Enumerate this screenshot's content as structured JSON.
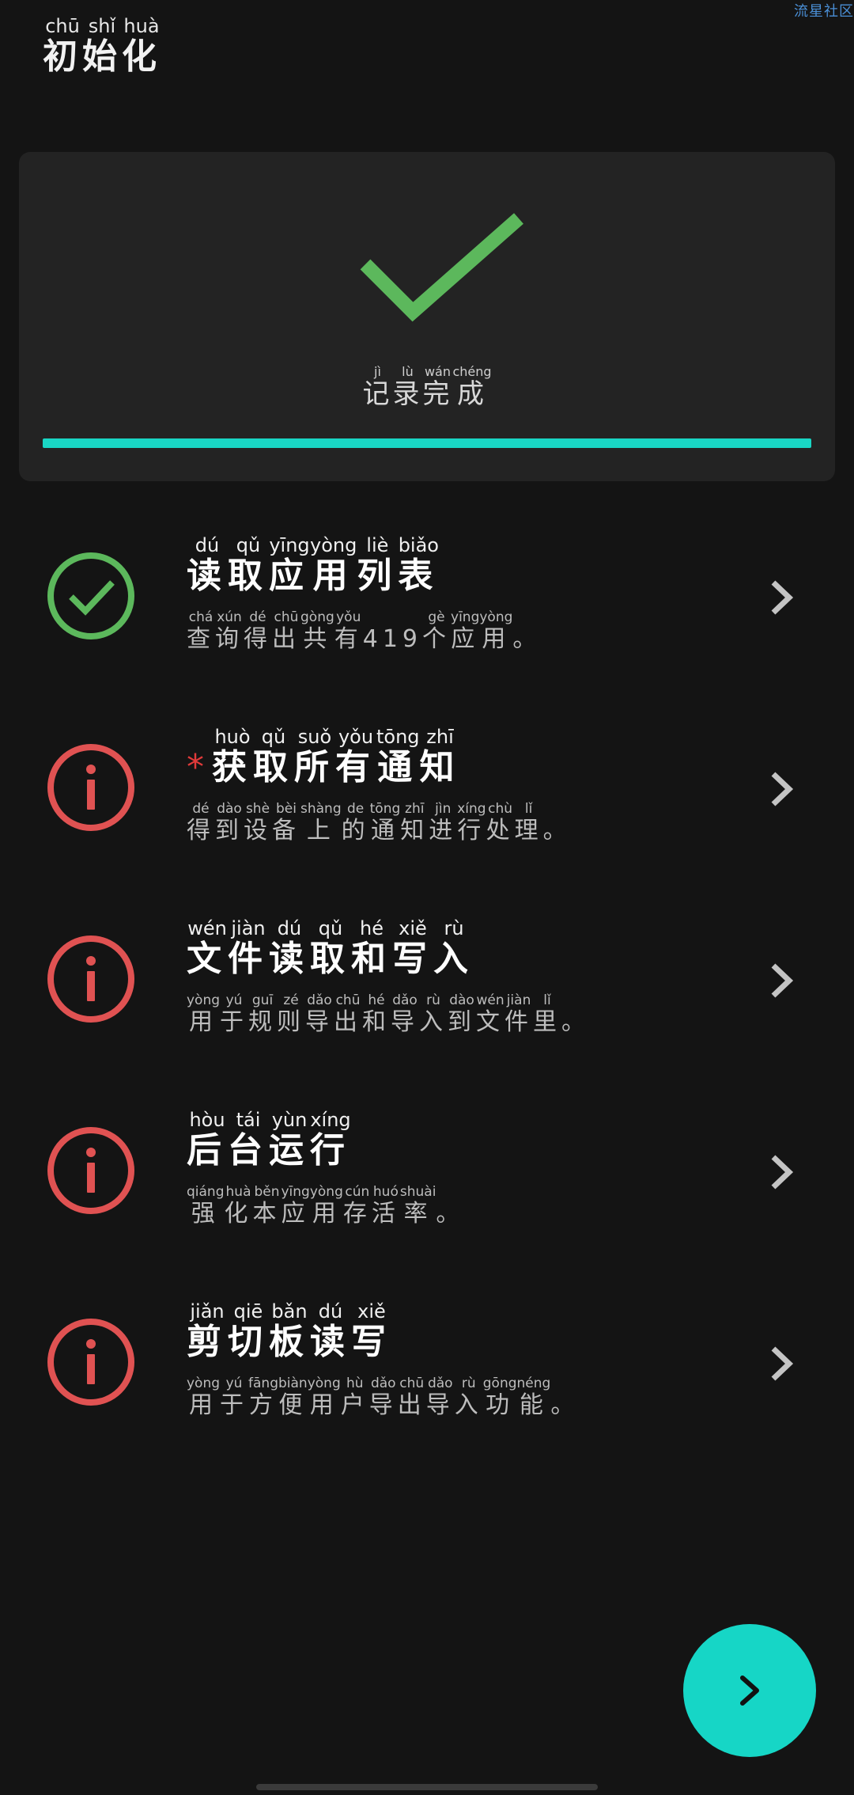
{
  "watermark": "流星社区",
  "header": {
    "title": [
      {
        "ch": "初",
        "py": "chū"
      },
      {
        "ch": "始",
        "py": "shǐ"
      },
      {
        "ch": "化",
        "py": "huà"
      }
    ]
  },
  "status": {
    "text": [
      {
        "ch": "记",
        "py": "jì"
      },
      {
        "ch": "录",
        "py": "lù"
      },
      {
        "ch": "完",
        "py": "wán"
      },
      {
        "ch": "成",
        "py": "chéng"
      }
    ],
    "progress_percent": 100,
    "check_color": "#5cb85c",
    "progress_color": "#19d6c4"
  },
  "permissions": [
    {
      "status": "granted",
      "required": false,
      "title": [
        {
          "ch": "读",
          "py": "dú"
        },
        {
          "ch": "取",
          "py": "qǔ"
        },
        {
          "ch": "应",
          "py": "yīng"
        },
        {
          "ch": "用",
          "py": "yòng"
        },
        {
          "ch": "列",
          "py": "liè"
        },
        {
          "ch": "表",
          "py": "biǎo"
        }
      ],
      "desc": [
        {
          "ch": "查",
          "py": "chá"
        },
        {
          "ch": "询",
          "py": "xún"
        },
        {
          "ch": "得",
          "py": "dé"
        },
        {
          "ch": "出",
          "py": "chū"
        },
        {
          "ch": "共",
          "py": "gòng"
        },
        {
          "ch": "有",
          "py": "yǒu"
        },
        {
          "ch": "419",
          "py": ""
        },
        {
          "ch": "个",
          "py": "gè"
        },
        {
          "ch": "应",
          "py": "yīng"
        },
        {
          "ch": "用",
          "py": "yòng"
        },
        {
          "ch": "。",
          "py": ""
        }
      ]
    },
    {
      "status": "not-granted",
      "required": true,
      "required_mark": "*",
      "title": [
        {
          "ch": "获",
          "py": "huò"
        },
        {
          "ch": "取",
          "py": "qǔ"
        },
        {
          "ch": "所",
          "py": "suǒ"
        },
        {
          "ch": "有",
          "py": "yǒu"
        },
        {
          "ch": "通",
          "py": "tōng"
        },
        {
          "ch": "知",
          "py": "zhī"
        }
      ],
      "desc": [
        {
          "ch": "得",
          "py": "dé"
        },
        {
          "ch": "到",
          "py": "dào"
        },
        {
          "ch": "设",
          "py": "shè"
        },
        {
          "ch": "备",
          "py": "bèi"
        },
        {
          "ch": "上",
          "py": "shàng"
        },
        {
          "ch": "的",
          "py": "de"
        },
        {
          "ch": "通",
          "py": "tōng"
        },
        {
          "ch": "知",
          "py": "zhī"
        },
        {
          "ch": "进",
          "py": "jìn"
        },
        {
          "ch": "行",
          "py": "xíng"
        },
        {
          "ch": "处",
          "py": "chù"
        },
        {
          "ch": "理",
          "py": "lǐ"
        },
        {
          "ch": "。",
          "py": ""
        }
      ]
    },
    {
      "status": "not-granted",
      "required": false,
      "title": [
        {
          "ch": "文",
          "py": "wén"
        },
        {
          "ch": "件",
          "py": "jiàn"
        },
        {
          "ch": "读",
          "py": "dú"
        },
        {
          "ch": "取",
          "py": "qǔ"
        },
        {
          "ch": "和",
          "py": "hé"
        },
        {
          "ch": "写",
          "py": "xiě"
        },
        {
          "ch": "入",
          "py": "rù"
        }
      ],
      "desc": [
        {
          "ch": "用",
          "py": "yòng"
        },
        {
          "ch": "于",
          "py": "yú"
        },
        {
          "ch": "规",
          "py": "guī"
        },
        {
          "ch": "则",
          "py": "zé"
        },
        {
          "ch": "导",
          "py": "dǎo"
        },
        {
          "ch": "出",
          "py": "chū"
        },
        {
          "ch": "和",
          "py": "hé"
        },
        {
          "ch": "导",
          "py": "dǎo"
        },
        {
          "ch": "入",
          "py": "rù"
        },
        {
          "ch": "到",
          "py": "dào"
        },
        {
          "ch": "文",
          "py": "wén"
        },
        {
          "ch": "件",
          "py": "jiàn"
        },
        {
          "ch": "里",
          "py": "lǐ"
        },
        {
          "ch": "。",
          "py": ""
        }
      ]
    },
    {
      "status": "not-granted",
      "required": false,
      "title": [
        {
          "ch": "后",
          "py": "hòu"
        },
        {
          "ch": "台",
          "py": "tái"
        },
        {
          "ch": "运",
          "py": "yùn"
        },
        {
          "ch": "行",
          "py": "xíng"
        }
      ],
      "desc": [
        {
          "ch": "强",
          "py": "qiáng"
        },
        {
          "ch": "化",
          "py": "huà"
        },
        {
          "ch": "本",
          "py": "běn"
        },
        {
          "ch": "应",
          "py": "yīng"
        },
        {
          "ch": "用",
          "py": "yòng"
        },
        {
          "ch": "存",
          "py": "cún"
        },
        {
          "ch": "活",
          "py": "huó"
        },
        {
          "ch": "率",
          "py": "shuài"
        },
        {
          "ch": "。",
          "py": ""
        }
      ]
    },
    {
      "status": "not-granted",
      "required": false,
      "title": [
        {
          "ch": "剪",
          "py": "jiǎn"
        },
        {
          "ch": "切",
          "py": "qiē"
        },
        {
          "ch": "板",
          "py": "bǎn"
        },
        {
          "ch": "读",
          "py": "dú"
        },
        {
          "ch": "写",
          "py": "xiě"
        }
      ],
      "desc": [
        {
          "ch": "用",
          "py": "yòng"
        },
        {
          "ch": "于",
          "py": "yú"
        },
        {
          "ch": "方",
          "py": "fāng"
        },
        {
          "ch": "便",
          "py": "biàn"
        },
        {
          "ch": "用",
          "py": "yòng"
        },
        {
          "ch": "户",
          "py": "hù"
        },
        {
          "ch": "导",
          "py": "dǎo"
        },
        {
          "ch": "出",
          "py": "chū"
        },
        {
          "ch": "导",
          "py": "dǎo"
        },
        {
          "ch": "入",
          "py": "rù"
        },
        {
          "ch": "功",
          "py": "gōng"
        },
        {
          "ch": "能",
          "py": "néng"
        },
        {
          "ch": "。",
          "py": ""
        }
      ]
    }
  ],
  "icons": {
    "granted": "check-circle-icon",
    "not_granted": "info-circle-icon",
    "chevron": "chevron-right-icon",
    "next": "next-arrow-icon"
  },
  "colors": {
    "background": "#141414",
    "card": "#232323",
    "granted": "#5cb85c",
    "not_granted": "#e05252",
    "accent": "#16d6c6",
    "required": "#e03a3a"
  }
}
